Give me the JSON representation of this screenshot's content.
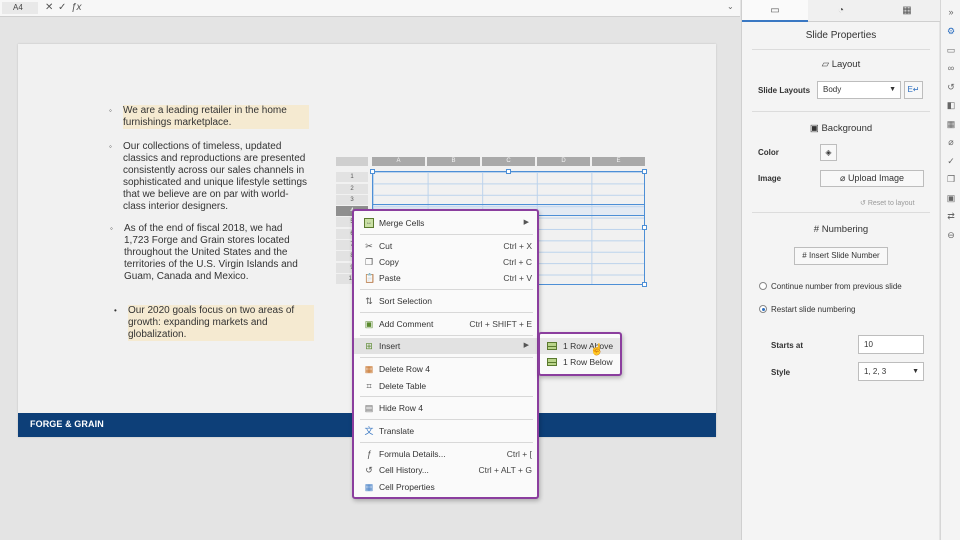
{
  "formula_bar": {
    "cell_ref": "A4",
    "cancel_icon": "✕",
    "confirm_icon": "✓",
    "fx_icon": "ƒx",
    "expand_icon": "⌄"
  },
  "slide": {
    "bullets": [
      {
        "text": "We are a leading retailer in the home furnishings marketplace."
      },
      {
        "text": "Our collections of timeless, updated classics and reproductions are presented consistently across our sales channels in sophisticated and unique lifestyle settings that we believe are on par with world-class interior designers."
      },
      {
        "text": "As of the end of fiscal 2018, we had 1,723 Forge and Grain stores located throughout the United States and the territories of the U.S. Virgin Islands and Guam, Canada and Mexico."
      },
      {
        "text": "Our 2020 goals focus on two areas of growth: expanding markets and globalization."
      }
    ],
    "footer": "FORGE & GRAIN",
    "table": {
      "columns": [
        "A",
        "B",
        "C",
        "D",
        "E"
      ],
      "rows": [
        "1",
        "2",
        "3",
        "4",
        "5",
        "6",
        "7",
        "8",
        "9",
        "10"
      ]
    }
  },
  "context_menu": {
    "items": [
      {
        "label": "Merge Cells",
        "shortcut": "",
        "icon": "merge-cells-icon"
      },
      {
        "label": "Cut",
        "shortcut": "Ctrl + X",
        "icon": "scissors-icon"
      },
      {
        "label": "Copy",
        "shortcut": "Ctrl + C",
        "icon": "copy-icon"
      },
      {
        "label": "Paste",
        "shortcut": "Ctrl + V",
        "icon": "paste-icon"
      },
      {
        "label": "Sort Selection",
        "shortcut": "",
        "icon": "sort-icon"
      },
      {
        "label": "Add Comment",
        "shortcut": "Ctrl + SHIFT + E",
        "icon": "comment-icon"
      },
      {
        "label": "Insert",
        "shortcut": "",
        "icon": "insert-icon"
      },
      {
        "label": "Delete Row 4",
        "shortcut": "",
        "icon": "delete-row-icon"
      },
      {
        "label": "Delete Table",
        "shortcut": "",
        "icon": "delete-table-icon"
      },
      {
        "label": "Hide Row 4",
        "shortcut": "",
        "icon": "hide-row-icon"
      },
      {
        "label": "Translate",
        "shortcut": "",
        "icon": "translate-icon"
      },
      {
        "label": "Formula Details...",
        "shortcut": "Ctrl + [",
        "icon": "formula-icon"
      },
      {
        "label": "Cell History...",
        "shortcut": "Ctrl + ALT + G",
        "icon": "history-icon"
      },
      {
        "label": "Cell Properties",
        "shortcut": "",
        "icon": "cell-properties-icon"
      }
    ],
    "submenu": [
      {
        "label": "1 Row Above"
      },
      {
        "label": "1 Row Below"
      }
    ]
  },
  "panel": {
    "title": "Slide Properties",
    "layout": {
      "heading": "Layout",
      "slide_layouts_label": "Slide Layouts",
      "slide_layouts_value": "Body"
    },
    "background": {
      "heading": "Background",
      "color_label": "Color",
      "image_label": "Image",
      "upload_label": "Upload Image",
      "reset_label": "Reset to layout"
    },
    "numbering": {
      "heading": "Numbering",
      "insert_button": "Insert Slide Number",
      "continue_label": "Continue number from previous slide",
      "restart_label": "Restart slide numbering",
      "restart_selected": true,
      "starts_at_label": "Starts at",
      "starts_at_value": "10",
      "style_label": "Style",
      "style_value": "1, 2, 3"
    }
  },
  "colors": {
    "accent": "#8b3e9e",
    "footer": "#0d3f78",
    "highlight": "#f5ead1",
    "selection": "#4d8fd6"
  }
}
